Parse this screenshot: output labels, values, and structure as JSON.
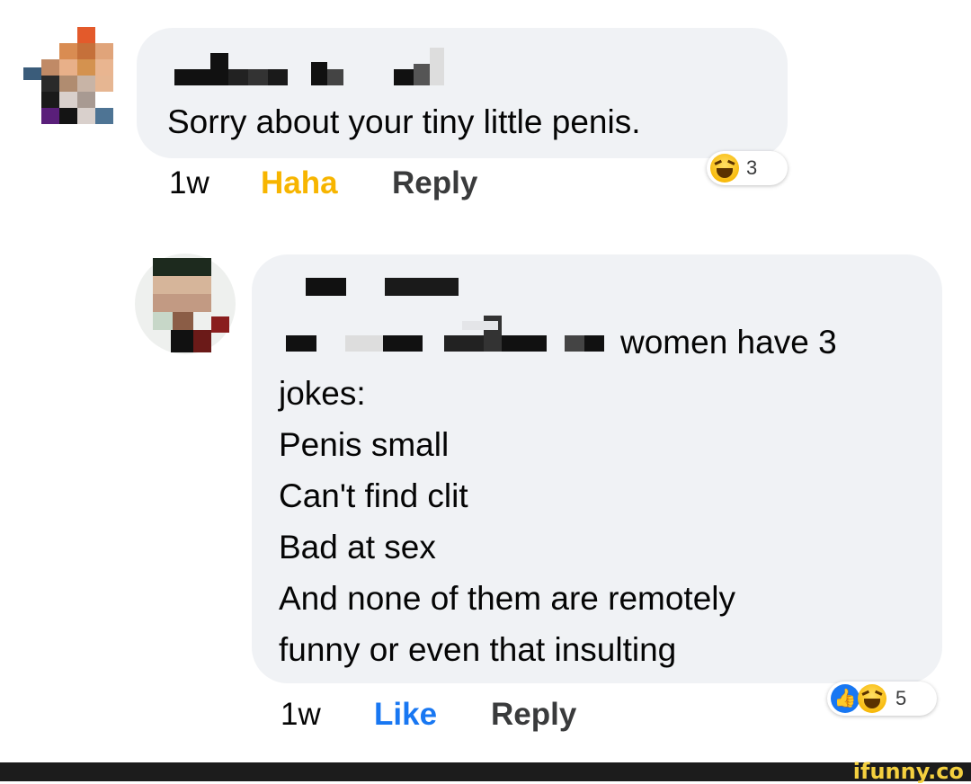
{
  "comments": [
    {
      "text_lines": [
        "Sorry about your tiny little penis."
      ],
      "time": "1w",
      "reacted_label": "Haha",
      "reply_label": "Reply",
      "reaction_icons": [
        "haha-icon"
      ],
      "reaction_count": "3"
    },
    {
      "text_lines": [
        "women have 3",
        "jokes:",
        "Penis small",
        "Can't find clit",
        "Bad at sex",
        "And none of them are remotely",
        "funny or even that insulting"
      ],
      "time": "1w",
      "like_label": "Like",
      "reply_label": "Reply",
      "reaction_icons": [
        "like-icon",
        "haha-icon"
      ],
      "reaction_count": "5"
    }
  ],
  "colors": {
    "haha": "#f7b500",
    "like": "#1877f2",
    "bubble": "#f0f2f5"
  },
  "watermark": {
    "text": "ifunny.co"
  }
}
